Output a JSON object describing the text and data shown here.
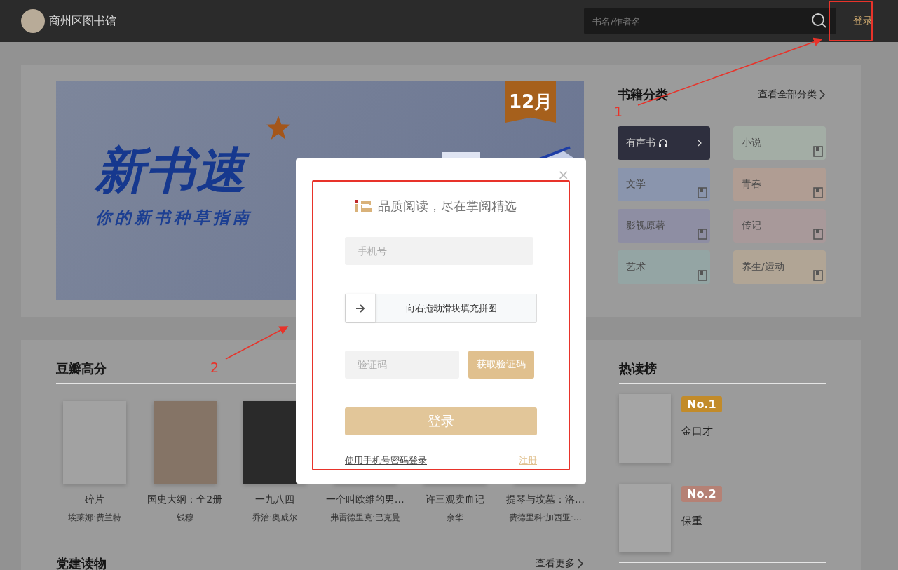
{
  "header": {
    "site_name": "商州区图书馆",
    "search": {
      "placeholder": "书名/作者名"
    },
    "login_link": "登录"
  },
  "banner": {
    "title": "新书速",
    "subtitle": "你的新书种草指南",
    "month_tag": "12月"
  },
  "categories": {
    "title": "书籍分类",
    "view_all": "查看全部分类",
    "items": [
      {
        "label": "有声书",
        "kind": "audio",
        "color": "#2e2f3e"
      },
      {
        "label": "小说",
        "kind": "book",
        "color": "#a3ada5"
      },
      {
        "label": "文学",
        "kind": "book",
        "color": "#8a95ad"
      },
      {
        "label": "青春",
        "kind": "book",
        "color": "#b09d93"
      },
      {
        "label": "影视原著",
        "kind": "book",
        "color": "#8e8ea3"
      },
      {
        "label": "传记",
        "kind": "book",
        "color": "#a8999a"
      },
      {
        "label": "艺术",
        "kind": "book",
        "color": "#94a5a4"
      },
      {
        "label": "养生/运动",
        "kind": "book",
        "color": "#b1a595"
      }
    ]
  },
  "douban": {
    "title": "豆瓣高分",
    "books": [
      {
        "title": "碎片",
        "author": "埃莱娜·费兰特",
        "color": "#a2a2a2"
      },
      {
        "title": "国史大纲：全2册",
        "author": "钱穆",
        "color": "#857466"
      },
      {
        "title": "一九八四",
        "author": "乔治·奥威尔",
        "color": "#2a2a2a"
      },
      {
        "title": "一个叫欧维的男…",
        "author": "弗雷德里克·巴克曼"
      },
      {
        "title": "许三观卖血记",
        "author": "余华"
      },
      {
        "title": "提琴与坟墓：洛…",
        "author": "费德里科·加西亚·…"
      }
    ]
  },
  "hot_list": {
    "title": "热读榜",
    "items": [
      {
        "rank": "No.1",
        "title": "金口才",
        "color": "#c28b2a"
      },
      {
        "rank": "No.2",
        "title": "保重",
        "color": "#b58175"
      }
    ]
  },
  "party_reading": {
    "title": "党建读物",
    "more": "查看更多"
  },
  "login_modal": {
    "close": "×",
    "slogan": "品质阅读，尽在掌阅精选",
    "phone": {
      "placeholder": "手机号"
    },
    "slider": {
      "hint": "向右拖动滑块填充拼图",
      "level": 0
    },
    "code": {
      "placeholder": "验证码"
    },
    "get_code": "获取验证码",
    "submit": {
      "label": "登录",
      "disabled": true
    },
    "password_login": "使用手机号密码登录",
    "register": "注册"
  },
  "annotations": [
    {
      "label": "1"
    },
    {
      "label": "2"
    }
  ]
}
